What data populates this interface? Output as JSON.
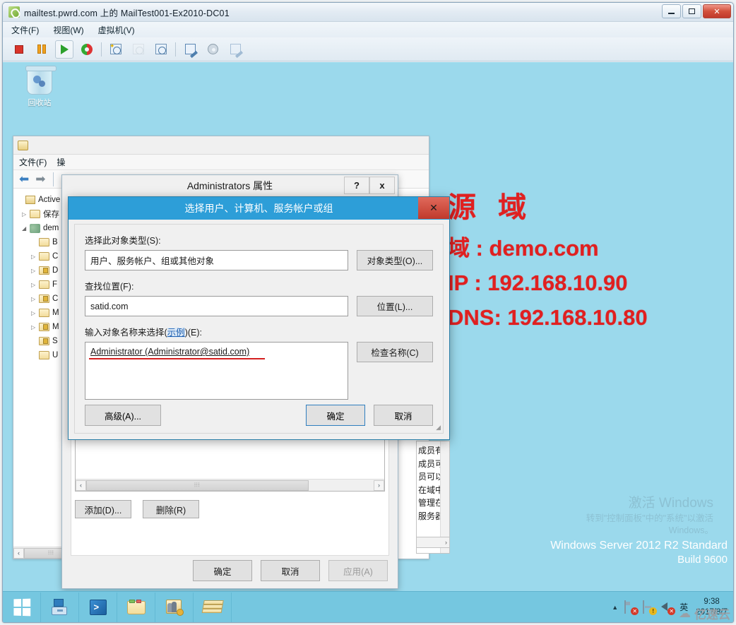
{
  "vmware": {
    "title": "mailtest.pwrd.com 上的 MailTest001-Ex2010-DC01",
    "title_icon": "vmware-vm-icon",
    "menus": [
      "文件(F)",
      "视图(W)",
      "虚拟机(V)"
    ],
    "window_buttons": {
      "minimize": "minimize-icon",
      "restore": "restore-icon",
      "close": "✕"
    },
    "toolbar_icons": [
      "power-off-icon",
      "suspend-icon",
      "power-on-icon",
      "reset-icon",
      "take-snapshot-icon",
      "revert-snapshot-icon",
      "snapshot-manager-icon",
      "unity-icon",
      "cd-settings-icon",
      "devices-icon"
    ]
  },
  "desktop": {
    "recycle_bin_label": "回收站",
    "background_color": "#9bd9ec"
  },
  "red_note": {
    "line1": "源 域",
    "line2": "域    : demo.com",
    "line3": "IP   : 192.168.10.90",
    "line4": "DNS: 192.168.10.80",
    "color": "#e02020"
  },
  "aduc": {
    "menu": [
      "文件(F)",
      "操"
    ],
    "nav_back": "back-arrow-icon",
    "nav_forward": "forward-arrow-icon",
    "tree": [
      {
        "label": "Active D",
        "expander": "",
        "icon": "console-root-icon"
      },
      {
        "label": "保存",
        "expander": "▷",
        "icon": "folder-icon"
      },
      {
        "label": "dem",
        "expander": "◢",
        "icon": "domain-icon"
      },
      {
        "label": "B",
        "expander": "",
        "icon": "folder-icon"
      },
      {
        "label": "C",
        "expander": "▷",
        "icon": "folder-icon"
      },
      {
        "label": "D",
        "expander": "▷",
        "icon": "folder-ou-icon"
      },
      {
        "label": "F",
        "expander": "▷",
        "icon": "folder-icon"
      },
      {
        "label": "C",
        "expander": "▷",
        "icon": "folder-ou-icon"
      },
      {
        "label": "M",
        "expander": "▷",
        "icon": "folder-icon"
      },
      {
        "label": "M",
        "expander": "▷",
        "icon": "folder-ou-icon"
      },
      {
        "label": "S",
        "expander": "",
        "icon": "folder-ou-icon"
      },
      {
        "label": "U",
        "expander": "",
        "icon": "folder-icon"
      }
    ],
    "hscroll_left": "‹",
    "hscroll_grip": "⦙⦙⦙"
  },
  "properties_dialog": {
    "title": "Administrators 属性",
    "help_button": "?",
    "close_button": "x",
    "list_hscroll_left": "‹",
    "list_hscroll_right": "›",
    "list_hscroll_grip": "⦙⦙⦙",
    "add_button": "添加(D)...",
    "remove_button": "删除(R)",
    "ok_button": "确定",
    "cancel_button": "取消",
    "apply_button": "应用(A)",
    "description_lines": [
      "成员有部",
      "成员可以",
      "员可以从",
      "在域中所",
      "管理在域",
      "服务器运"
    ],
    "desc_scroll_down": "⌄",
    "desc_scroll_right": "›"
  },
  "select_dialog": {
    "title": "选择用户、计算机、服务帐户或组",
    "close_button": "✕",
    "object_type_label": "选择此对象类型(S):",
    "object_type_value": "用户、服务帐户、组或其他对象",
    "object_type_button": "对象类型(O)...",
    "location_label": "查找位置(F):",
    "location_value": "satid.com",
    "location_button": "位置(L)...",
    "names_label_prefix": "输入对象名称来选择(",
    "names_label_link": "示例",
    "names_label_suffix": ")(E):",
    "names_value": "Administrator (Administrator@satid.com)",
    "check_names_button": "检查名称(C)",
    "advanced_button": "高级(A)...",
    "ok_button": "确定",
    "cancel_button": "取消",
    "annotation_color": "#d41f1f",
    "resize_grip": "◢"
  },
  "activation_watermark": {
    "line1": "激活 Windows",
    "line2": "转到\"控制面板\"中的\"系统\"以激活",
    "line3": "Windows。"
  },
  "system_watermark": {
    "line1": "Windows Server 2012 R2 Standard",
    "line2": "Build 9600"
  },
  "taskbar": {
    "start_icon": "windows-start-icon",
    "pinned": [
      "server-manager-icon",
      "powershell-icon",
      "file-explorer-icon",
      "active-directory-users-icon",
      "books-icon"
    ],
    "tray": {
      "caret": "▲",
      "icons": [
        "action-center-flag-icon",
        "network-icon",
        "volume-icon"
      ],
      "ime": "英",
      "time": "9:38",
      "date": "2017/8/7"
    }
  },
  "brand_watermark": {
    "icon": "cloud-icon",
    "text": "亿速云"
  }
}
